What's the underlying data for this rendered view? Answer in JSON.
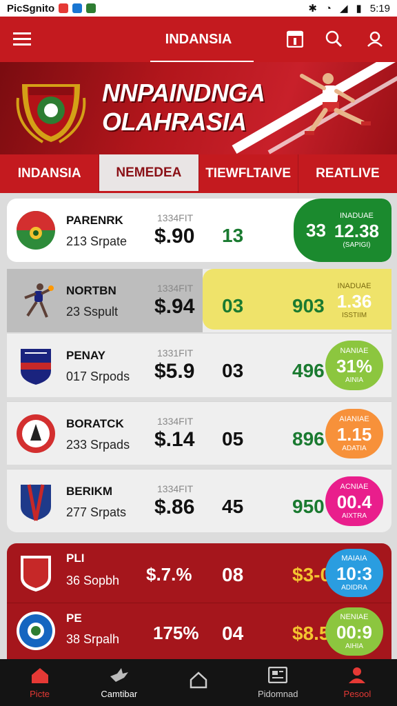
{
  "status": {
    "app_label": "PicSgnito",
    "time": "5:19"
  },
  "appbar": {
    "title": "INDANSIA"
  },
  "banner": {
    "line1": "NNPAINDNGA",
    "line2": "OLAHRASIA"
  },
  "tabs": [
    {
      "label": "INDANSIA"
    },
    {
      "label": "NEMEDEA"
    },
    {
      "label": "TIEWFLTAIVE"
    },
    {
      "label": "REATLIVE"
    }
  ],
  "rows": [
    {
      "name": "PARENRK",
      "sub": "213 Srpate",
      "small": "1334FIT",
      "price": "$.90",
      "n1": "13",
      "n2": "",
      "pill": {
        "label": "INADUAE",
        "value": "12.38",
        "sub": "(SAPIGI)",
        "prefix": "33",
        "color": "#1b8a2e"
      }
    },
    {
      "name": "NORTBN",
      "sub": "23 Sspult",
      "small": "1334FIT",
      "price": "$.94",
      "n1": "03",
      "n2": "903",
      "pill": {
        "label": "INADUAE",
        "value": "1.36",
        "sub": "ISSTIIM",
        "color": "#e9dc52"
      }
    },
    {
      "name": "PENAY",
      "sub": "017 Srpods",
      "small": "1331FIT",
      "price": "$5.9",
      "n1": "03",
      "n2": "496",
      "pill": {
        "label": "NANIAE",
        "value": "31%",
        "sub": "AINIA",
        "color": "#8cc63f"
      }
    },
    {
      "name": "BORATCK",
      "sub": "233 Srpads",
      "small": "1334FIT",
      "price": "$.14",
      "n1": "05",
      "n2": "896",
      "pill": {
        "label": "AIANIAE",
        "value": "1.15",
        "sub": "ADATIA",
        "color": "#f7913a"
      }
    },
    {
      "name": "BERIKM",
      "sub": "277 Srpats",
      "small": "1334FIT",
      "price": "$.86",
      "n1": "45",
      "n2": "950",
      "pill": {
        "label": "ACNIAE",
        "value": "00.4",
        "sub": "AIXTRA",
        "color": "#e91e8c"
      }
    },
    {
      "name": "PLI",
      "sub": "36 Sopbh",
      "small": "",
      "price": "$.7.%",
      "n1": "08",
      "n2": "$3-0",
      "pill": {
        "label": "MAIAIA",
        "value": "10:3",
        "sub": "ADIDRA",
        "color": "#2a9de0"
      }
    },
    {
      "name": "PE",
      "sub": "38 Srpalh",
      "small": "",
      "price": "175%",
      "n1": "04",
      "n2": "$8.5",
      "pill": {
        "label": "NENIAE",
        "value": "00:9",
        "sub": "AIHIA",
        "color": "#8cc63f"
      }
    }
  ],
  "nav": [
    {
      "label": "Picte",
      "icon": "home-icon"
    },
    {
      "label": "Camtibar",
      "icon": "bird-icon"
    },
    {
      "label": "",
      "icon": "house-outline-icon"
    },
    {
      "label": "Pidomnad",
      "icon": "news-icon"
    },
    {
      "label": "Pesool",
      "icon": "person-icon"
    }
  ]
}
